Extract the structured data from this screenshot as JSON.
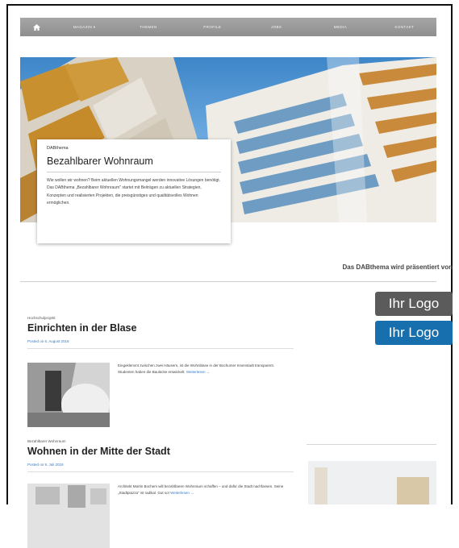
{
  "nav": {
    "items": [
      "MAGAZIN ▾",
      "THEMEN",
      "PROFILE",
      "JOBS",
      "MEDIA",
      "KONTAKT"
    ]
  },
  "hero": {
    "kicker": "DABthema",
    "title": "Bezahlbarer Wohnraum",
    "body": "Wie wollen wir wohnen? Beim aktuellen Wohnungsmangel werden innovative Lösungen benötigt. Das DABthema „Bezahlbarer Wohnraum\" startet mit Beiträgen zu aktuellen Strategien, Konzepten und realisierten Projekten, die preisgünstiges und qualitätsvolles Wohnen ermöglichen."
  },
  "sponsor": {
    "text": "Das DABthema wird präsentiert von",
    "logos": [
      "Ihr Logo",
      "Ihr Logo"
    ]
  },
  "posts": [
    {
      "kicker": "Hochschulprojekt",
      "title": "Einrichten in der Blase",
      "date": "Posted on 6. August 2018",
      "excerpt": "Eingeklemmt zwischen zwei Häusern, ist die Wohnblase in der Bochumer Innenstadt transparent. Studenten haben die Baulücke entwickelt.",
      "more": "Weiterlesen →"
    },
    {
      "kicker": "Bezahlbarer Wohnraum",
      "title": "Wohnen in der Mitte der Stadt",
      "date": "Posted on 9. Juli 2018",
      "excerpt": "Architekt Martin Bochem will bezahlbaren Wohnraum schaffen – und dafür die Stadt nachfassen. Seine „Stadtpiazza\" ist radikal. Gut so!",
      "more": "Weiterlesen →"
    }
  ]
}
